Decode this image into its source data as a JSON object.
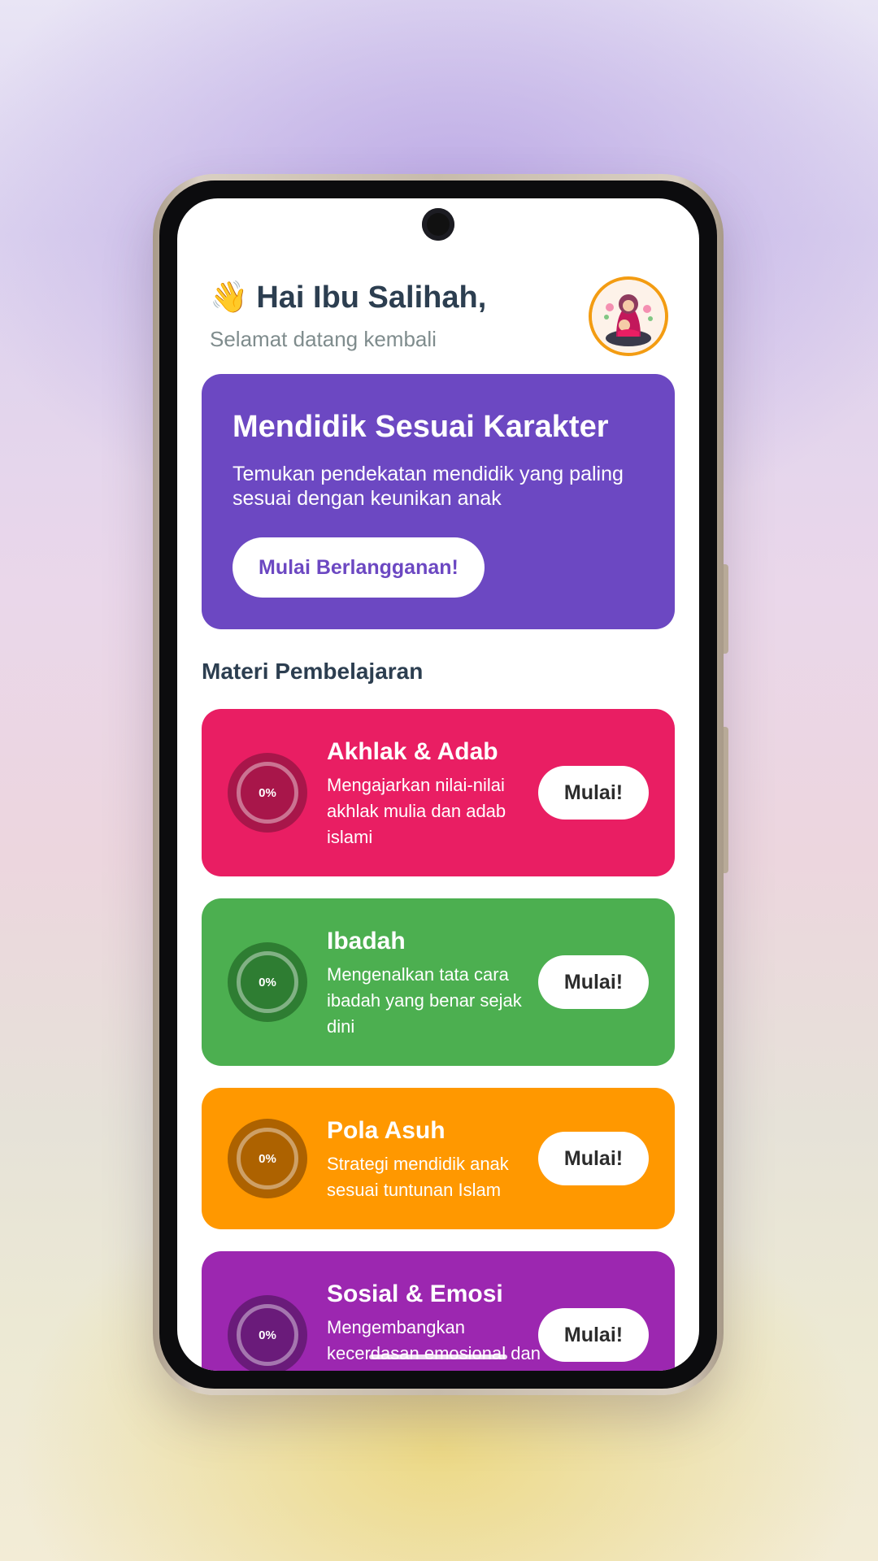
{
  "header": {
    "greeting": "Hai Ibu Salihah,",
    "subtitle": "Selamat datang kembali"
  },
  "hero": {
    "title": "Mendidik Sesuai Karakter",
    "description": "Temukan pendekatan mendidik yang paling sesuai dengan keunikan anak",
    "button_label": "Mulai Berlangganan!"
  },
  "section_title": "Materi Pembelajaran",
  "materials": [
    {
      "title": "Akhlak & Adab",
      "description": "Mengajarkan nilai-nilai akhlak mulia dan adab islami",
      "progress": "0%",
      "button_label": "Mulai!",
      "color": "#e91e63",
      "ring_color": "#a8164a"
    },
    {
      "title": "Ibadah",
      "description": "Mengenalkan tata cara ibadah yang benar sejak dini",
      "progress": "0%",
      "button_label": "Mulai!",
      "color": "#4caf50",
      "ring_color": "#2e7d32"
    },
    {
      "title": "Pola Asuh",
      "description": "Strategi mendidik anak sesuai tuntunan Islam",
      "progress": "0%",
      "button_label": "Mulai!",
      "color": "#ff9800",
      "ring_color": "#ad6200"
    },
    {
      "title": "Sosial & Emosi",
      "description": "Mengembangkan kecerdasan emosional dan",
      "progress": "0%",
      "button_label": "Mulai!",
      "color": "#9c27b0",
      "ring_color": "#6a1b7a"
    }
  ],
  "colors": {
    "primary": "#6c48c2",
    "text_dark": "#2c3e50",
    "text_muted": "#7f8c8d",
    "avatar_border": "#f39c12"
  }
}
